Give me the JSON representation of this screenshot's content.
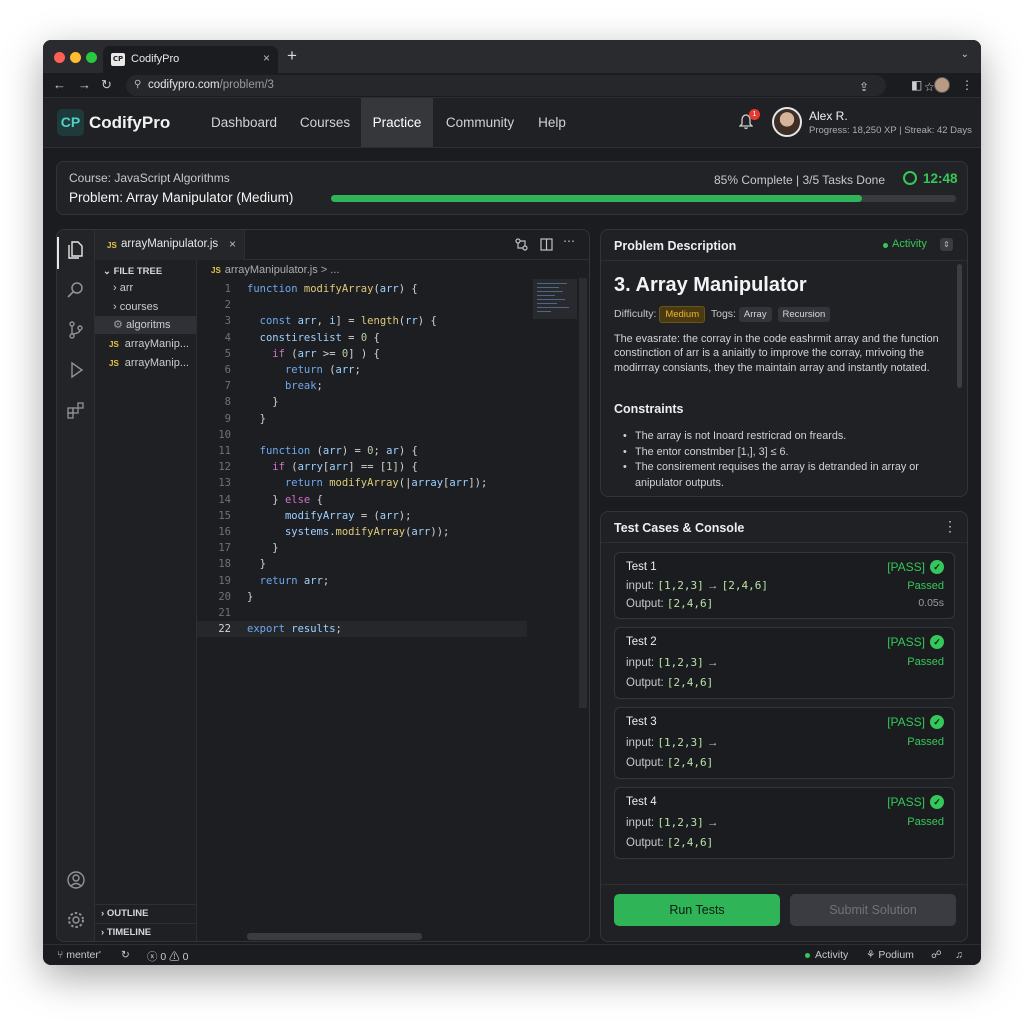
{
  "browser": {
    "tab_favicon": "CP",
    "tab_title": "CodifyPro",
    "tab_close": "×",
    "new_tab": "+",
    "tab_menu": "⌄",
    "back": "←",
    "forward": "→",
    "reload": "↻",
    "lock_icon": "⚲",
    "url_domain": "codifypro.com",
    "url_path": "/problem/3",
    "share_icon": "⇪",
    "star_icon": "☆",
    "sidebar_icon": "◧",
    "menu_icon": "⋮"
  },
  "header": {
    "logo_badge": "CP",
    "logo_text": "CodifyPro",
    "nav": [
      {
        "label": "Dashboard",
        "active": false
      },
      {
        "label": "Courses",
        "active": false
      },
      {
        "label": "Practice",
        "active": true
      },
      {
        "label": "Community",
        "active": false
      },
      {
        "label": "Help",
        "active": false
      }
    ],
    "notification_icon": "bell-icon",
    "notification_count": "1",
    "user_name": "Alex R.",
    "user_stats": "Progress: 18,250 XP  |  Streak: 42 Days"
  },
  "progress": {
    "course": "Course: JavaScript Algorithms",
    "problem": "Problem: Array Manipulator (Medium)",
    "status": "85% Complete | 3/5 Tasks Done",
    "percent": 85,
    "timer": "12:48",
    "accent": "#2fb457"
  },
  "editor": {
    "tab_lang": "JS",
    "tab_title": "arrayManipulator.js",
    "tab_close": "×",
    "breadcrumb": "arrayManipulator.js > ...",
    "explorer_title": "FILE TREE",
    "tree": [
      {
        "label": "arr",
        "type": "folder"
      },
      {
        "label": "courses",
        "type": "folder"
      },
      {
        "label": "algoritms",
        "type": "folder-open",
        "selected": true
      },
      {
        "label": "arrayManip...",
        "type": "js"
      },
      {
        "label": "arrayManip...",
        "type": "js"
      }
    ],
    "outline_label": "OUTLINE",
    "timeline_label": "TIMELINE",
    "code": [
      {
        "n": "1",
        "t": "function modifyArray(arr) {"
      },
      {
        "n": "2",
        "t": ""
      },
      {
        "n": "3",
        "t": "  const arr, i] = length(rr) {"
      },
      {
        "n": "4",
        "t": "  constireslist = 0 {"
      },
      {
        "n": "5",
        "t": "    if (arr >= 0] ) {"
      },
      {
        "n": "6",
        "t": "      return (arr;"
      },
      {
        "n": "7",
        "t": "      break;"
      },
      {
        "n": "8",
        "t": "    }"
      },
      {
        "n": "9",
        "t": "  }"
      },
      {
        "n": "10",
        "t": ""
      },
      {
        "n": "11",
        "t": "  function (arr) = 0; ar) {"
      },
      {
        "n": "12",
        "t": "    if (arry[arr] == [1]) {"
      },
      {
        "n": "13",
        "t": "      return modifyArray(|array[arr]);"
      },
      {
        "n": "14",
        "t": "    } else {"
      },
      {
        "n": "15",
        "t": "      modifyArray = (arr);"
      },
      {
        "n": "16",
        "t": "      systems.modifyArray(arr));"
      },
      {
        "n": "17",
        "t": "    }"
      },
      {
        "n": "18",
        "t": "  }"
      },
      {
        "n": "19",
        "t": "  return arr;"
      },
      {
        "n": "20",
        "t": "}"
      },
      {
        "n": "21",
        "t": ""
      },
      {
        "n": "22",
        "t": "export results;"
      }
    ]
  },
  "description": {
    "panel_title": "Problem Description",
    "activity_label": "Activity",
    "heading": "3. Array Manipulator",
    "difficulty_label": "Difficulty:",
    "difficulty": "Medium",
    "tags_label": "Togs:",
    "tags": [
      "Array",
      "Recursion"
    ],
    "body": "The evasrate: the corray in the code eashrmit array and the function constinction of arr is a aniaitly to improve the corray, mrivoing the modirrray consiants, they the maintain array and instantly notated.",
    "constraints_title": "Constraints",
    "constraints": [
      "The array is not Inoard restricrad on freards.",
      "The entor constmber [1,], 3] ≤ 6.",
      "The consirement requises the array is detranded in array or anipulator outputs."
    ]
  },
  "tests": {
    "panel_title": "Test Cases & Console",
    "more_icon": "⋮",
    "cases": [
      {
        "name": "Test 1",
        "status": "[PASS]",
        "input_label": "input:",
        "input": "[1,2,3]",
        "arrow": "→",
        "expected": "[2,4,6]",
        "output_label": "Output:",
        "output": "[2,4,6]",
        "result": "Passed",
        "time": "0.05s"
      },
      {
        "name": "Test 2",
        "status": "[PASS]",
        "input_label": "input:",
        "input": "[1,2,3]",
        "arrow": "→",
        "expected": "",
        "output_label": "Output:",
        "output": "[2,4,6]",
        "result": "Passed",
        "time": ""
      },
      {
        "name": "Test 3",
        "status": "[PASS]",
        "input_label": "input:",
        "input": "[1,2,3]",
        "arrow": "→",
        "expected": "",
        "output_label": "Output:",
        "output": "[2,4,6]",
        "result": "Passed",
        "time": ""
      },
      {
        "name": "Test 4",
        "status": "[PASS]",
        "input_label": "input:",
        "input": "[1,2,3]",
        "arrow": "→",
        "expected": "",
        "output_label": "Output:",
        "output": "[2,4,6]",
        "result": "Passed",
        "time": ""
      }
    ],
    "run_label": "Run Tests",
    "submit_label": "Submit Solution"
  },
  "statusbar": {
    "branch": "menter'",
    "sync_icon": "↻",
    "problems": "ⓧ 0 ⚠ 0",
    "activity": "Activity",
    "podium": "⚘ Podium",
    "feedback_icon": "☍",
    "bell_icon": "♫"
  }
}
